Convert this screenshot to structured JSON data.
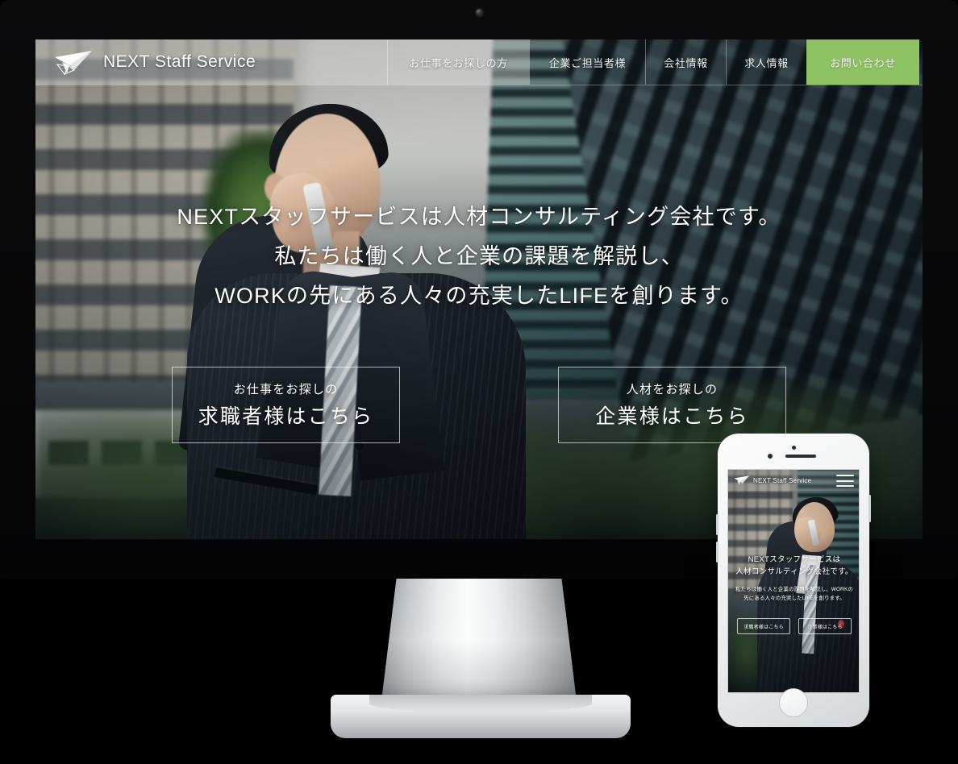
{
  "device": {
    "monitor_name": "imac-monitor",
    "webcam": "webcam-dot",
    "phone_name": "iphone-mockup"
  },
  "colors": {
    "cta_green": "#8fc263",
    "text_white": "#ffffff",
    "header_overlay": "rgba(225,226,222,0.40)",
    "monitor_black": "#0b0b0c",
    "phone_white": "#fdfdfd"
  },
  "site": {
    "brand": {
      "name": "NEXT Staff Service",
      "logo_icon": "paper-plane-icon"
    },
    "nav": {
      "items": [
        {
          "label": "お仕事をお探しの方",
          "active": true
        },
        {
          "label": "企業ご担当者様",
          "active": false
        },
        {
          "label": "会社情報",
          "active": false
        },
        {
          "label": "求人情報",
          "active": false
        }
      ],
      "cta": {
        "label": "お問い合わせ"
      }
    },
    "hero": {
      "lines": [
        "NEXTスタッフサービスは人材コンサルティング会社です。",
        "私たちは働く人と企業の課題を解説し、",
        "WORKの先にある人々の充実したLIFEを創ります。"
      ],
      "buttons": [
        {
          "small": "お仕事をお探しの",
          "large": "求職者様はこちら"
        },
        {
          "small": "人材をお探しの",
          "large": "企業様はこちら"
        }
      ]
    }
  },
  "mobile": {
    "brand": {
      "name": "NEXT Staff Service",
      "logo_icon": "paper-plane-icon"
    },
    "menu_icon": "hamburger-menu-icon",
    "hero": {
      "title_lines": [
        "NEXTスタッフサービスは",
        "人材コンサルティング会社です。"
      ],
      "subtitle": "私たちは働く人と企業の課題を解説し、WORKの先にある人々の充実したLIFEを創ります。",
      "buttons": [
        {
          "label": "求職者様はこちら"
        },
        {
          "label": "企業様はこちら"
        }
      ]
    }
  }
}
